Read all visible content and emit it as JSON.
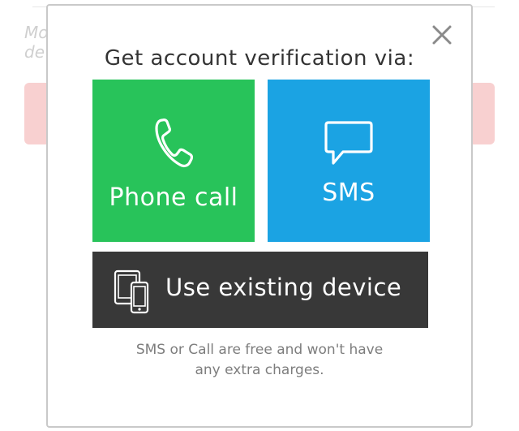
{
  "background": {
    "partial_text_lines": [
      "Mo",
      "de"
    ]
  },
  "modal": {
    "title": "Get account verification via:",
    "close_icon": "close-icon",
    "options": {
      "phone_call": {
        "label": "Phone call",
        "icon": "phone-icon",
        "color": "#28c35a"
      },
      "sms": {
        "label": "SMS",
        "icon": "chat-bubble-icon",
        "color": "#1ba3e3"
      },
      "existing_device": {
        "label": "Use existing device",
        "icon": "devices-icon",
        "color": "#383838"
      }
    },
    "footnote_lines": [
      "SMS or Call are free and won't have",
      "any extra charges."
    ]
  }
}
